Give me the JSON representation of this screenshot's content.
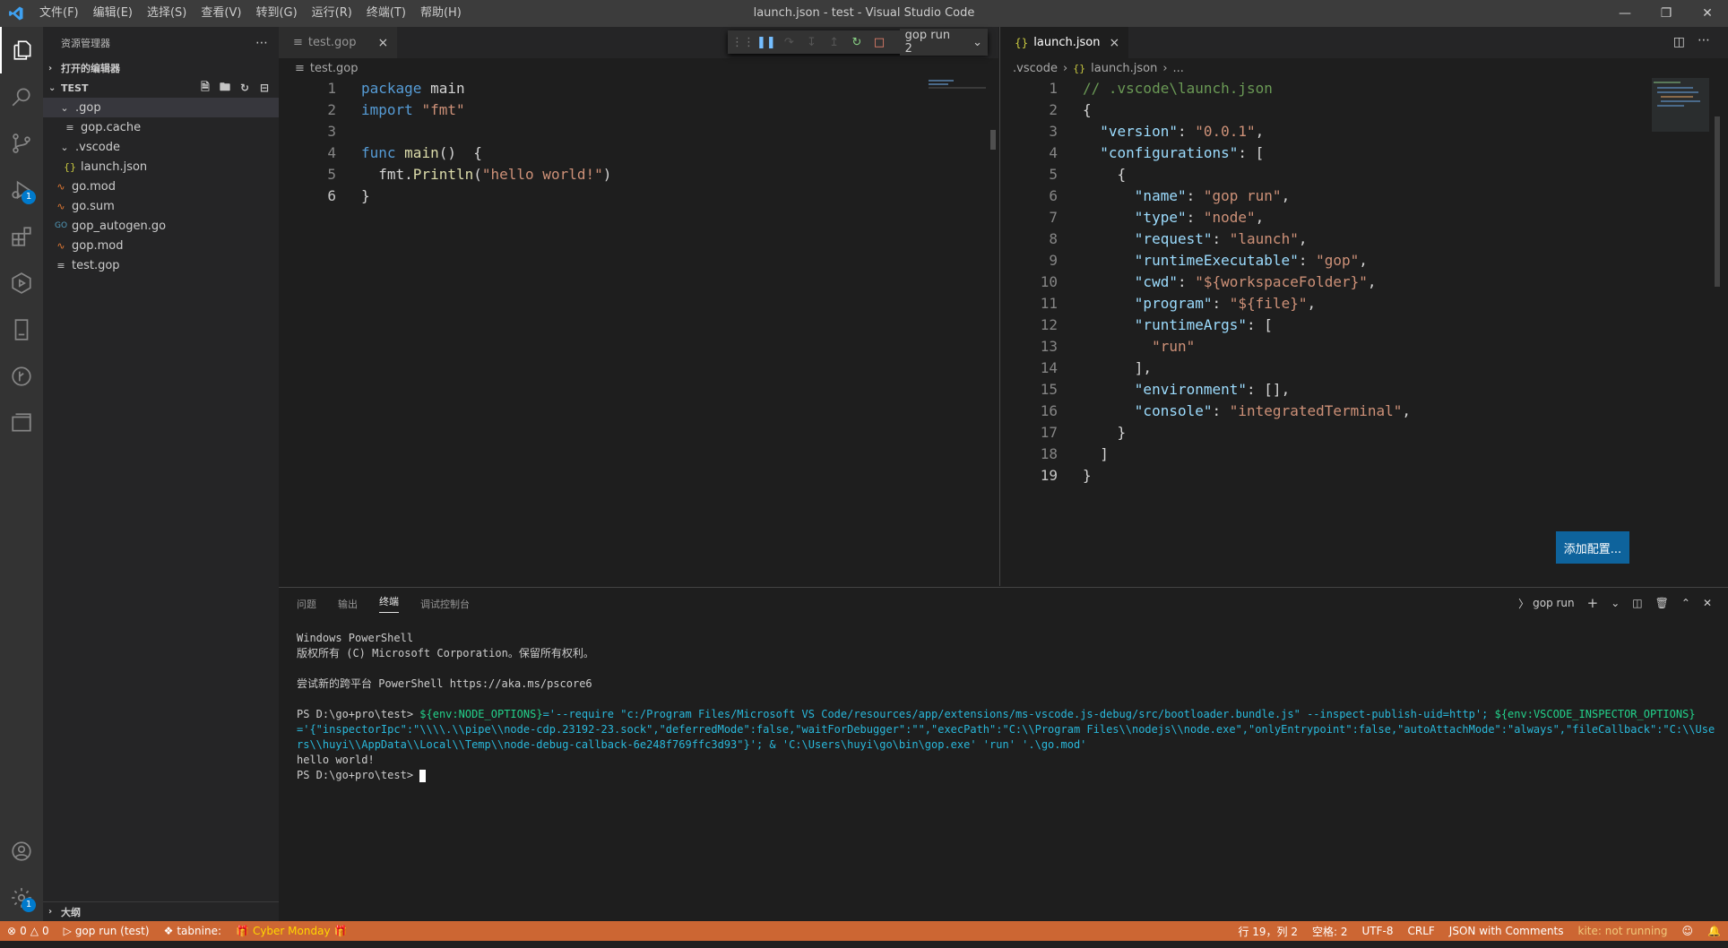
{
  "window": {
    "title": "launch.json - test - Visual Studio Code",
    "menu": [
      "文件(F)",
      "编辑(E)",
      "选择(S)",
      "查看(V)",
      "转到(G)",
      "运行(R)",
      "终端(T)",
      "帮助(H)"
    ]
  },
  "activity": {
    "run_badge": "1",
    "settings_badge": "1"
  },
  "sidebar": {
    "title": "资源管理器",
    "open_editors": "打开的编辑器",
    "folder": "TEST",
    "outline": "大纲",
    "tree": [
      {
        "label": ".gop",
        "type": "folder",
        "indent": 1
      },
      {
        "label": "gop.cache",
        "type": "file",
        "indent": 2
      },
      {
        "label": ".vscode",
        "type": "folder",
        "indent": 1
      },
      {
        "label": "launch.json",
        "type": "json",
        "indent": 2
      },
      {
        "label": "go.mod",
        "type": "mod",
        "indent": 1
      },
      {
        "label": "go.sum",
        "type": "mod",
        "indent": 1
      },
      {
        "label": "gop_autogen.go",
        "type": "go",
        "indent": 1
      },
      {
        "label": "gop.mod",
        "type": "mod",
        "indent": 1
      },
      {
        "label": "test.gop",
        "type": "file",
        "indent": 1
      }
    ]
  },
  "left_editor": {
    "tab": "test.gop",
    "breadcrumb": "test.gop",
    "lines": [
      {
        "n": "1",
        "parts": [
          {
            "c": "kw",
            "t": "package"
          },
          {
            "c": "plain",
            "t": " main"
          }
        ]
      },
      {
        "n": "2",
        "parts": [
          {
            "c": "kw",
            "t": "import"
          },
          {
            "c": "plain",
            "t": " "
          },
          {
            "c": "str",
            "t": "\"fmt\""
          }
        ]
      },
      {
        "n": "3",
        "parts": []
      },
      {
        "n": "4",
        "parts": [
          {
            "c": "kw",
            "t": "func"
          },
          {
            "c": "plain",
            "t": " "
          },
          {
            "c": "fn",
            "t": "main"
          },
          {
            "c": "plain",
            "t": "()  {"
          }
        ]
      },
      {
        "n": "5",
        "parts": [
          {
            "c": "plain",
            "t": "  fmt."
          },
          {
            "c": "fn",
            "t": "Println"
          },
          {
            "c": "plain",
            "t": "("
          },
          {
            "c": "str",
            "t": "\"hello world!\""
          },
          {
            "c": "plain",
            "t": ")"
          }
        ]
      },
      {
        "n": "6",
        "parts": [
          {
            "c": "plain",
            "t": "}"
          }
        ]
      }
    ]
  },
  "debug_toolbar": {
    "config": "gop run 2"
  },
  "right_editor": {
    "tab": "launch.json",
    "breadcrumb": [
      ".vscode",
      "launch.json",
      "..."
    ],
    "add_config": "添加配置...",
    "lines": [
      {
        "n": "1",
        "parts": [
          {
            "c": "cmt",
            "t": "// .vscode\\launch.json"
          }
        ]
      },
      {
        "n": "2",
        "parts": [
          {
            "c": "plain",
            "t": "{"
          }
        ]
      },
      {
        "n": "3",
        "parts": [
          {
            "c": "plain",
            "t": "  "
          },
          {
            "c": "key",
            "t": "\"version\""
          },
          {
            "c": "plain",
            "t": ": "
          },
          {
            "c": "str",
            "t": "\"0.0.1\""
          },
          {
            "c": "plain",
            "t": ","
          }
        ]
      },
      {
        "n": "4",
        "parts": [
          {
            "c": "plain",
            "t": "  "
          },
          {
            "c": "key",
            "t": "\"configurations\""
          },
          {
            "c": "plain",
            "t": ": ["
          }
        ]
      },
      {
        "n": "5",
        "parts": [
          {
            "c": "plain",
            "t": "    {"
          }
        ]
      },
      {
        "n": "6",
        "parts": [
          {
            "c": "plain",
            "t": "      "
          },
          {
            "c": "key",
            "t": "\"name\""
          },
          {
            "c": "plain",
            "t": ": "
          },
          {
            "c": "str",
            "t": "\"gop run\""
          },
          {
            "c": "plain",
            "t": ","
          }
        ]
      },
      {
        "n": "7",
        "parts": [
          {
            "c": "plain",
            "t": "      "
          },
          {
            "c": "key",
            "t": "\"type\""
          },
          {
            "c": "plain",
            "t": ": "
          },
          {
            "c": "str",
            "t": "\"node\""
          },
          {
            "c": "plain",
            "t": ","
          }
        ]
      },
      {
        "n": "8",
        "parts": [
          {
            "c": "plain",
            "t": "      "
          },
          {
            "c": "key",
            "t": "\"request\""
          },
          {
            "c": "plain",
            "t": ": "
          },
          {
            "c": "str",
            "t": "\"launch\""
          },
          {
            "c": "plain",
            "t": ","
          }
        ]
      },
      {
        "n": "9",
        "parts": [
          {
            "c": "plain",
            "t": "      "
          },
          {
            "c": "key",
            "t": "\"runtimeExecutable\""
          },
          {
            "c": "plain",
            "t": ": "
          },
          {
            "c": "str",
            "t": "\"gop\""
          },
          {
            "c": "plain",
            "t": ","
          }
        ]
      },
      {
        "n": "10",
        "parts": [
          {
            "c": "plain",
            "t": "      "
          },
          {
            "c": "key",
            "t": "\"cwd\""
          },
          {
            "c": "plain",
            "t": ": "
          },
          {
            "c": "str",
            "t": "\"${workspaceFolder}\""
          },
          {
            "c": "plain",
            "t": ","
          }
        ]
      },
      {
        "n": "11",
        "parts": [
          {
            "c": "plain",
            "t": "      "
          },
          {
            "c": "key",
            "t": "\"program\""
          },
          {
            "c": "plain",
            "t": ": "
          },
          {
            "c": "str",
            "t": "\"${file}\""
          },
          {
            "c": "plain",
            "t": ","
          }
        ]
      },
      {
        "n": "12",
        "parts": [
          {
            "c": "plain",
            "t": "      "
          },
          {
            "c": "key",
            "t": "\"runtimeArgs\""
          },
          {
            "c": "plain",
            "t": ": ["
          }
        ]
      },
      {
        "n": "13",
        "parts": [
          {
            "c": "plain",
            "t": "        "
          },
          {
            "c": "str",
            "t": "\"run\""
          }
        ]
      },
      {
        "n": "14",
        "parts": [
          {
            "c": "plain",
            "t": "      ],"
          }
        ]
      },
      {
        "n": "15",
        "parts": [
          {
            "c": "plain",
            "t": "      "
          },
          {
            "c": "key",
            "t": "\"environment\""
          },
          {
            "c": "plain",
            "t": ": [],"
          }
        ]
      },
      {
        "n": "16",
        "parts": [
          {
            "c": "plain",
            "t": "      "
          },
          {
            "c": "key",
            "t": "\"console\""
          },
          {
            "c": "plain",
            "t": ": "
          },
          {
            "c": "str",
            "t": "\"integratedTerminal\""
          },
          {
            "c": "plain",
            "t": ","
          }
        ]
      },
      {
        "n": "17",
        "parts": [
          {
            "c": "plain",
            "t": "    }"
          }
        ]
      },
      {
        "n": "18",
        "parts": [
          {
            "c": "plain",
            "t": "  ]"
          }
        ]
      },
      {
        "n": "19",
        "parts": [
          {
            "c": "plain",
            "t": "}"
          }
        ]
      }
    ]
  },
  "panel": {
    "tabs": [
      "问题",
      "输出",
      "终端",
      "调试控制台"
    ],
    "terminal_name": "gop run",
    "terminal_lines": [
      {
        "c": "",
        "t": "Windows PowerShell"
      },
      {
        "c": "",
        "t": "版权所有 (C) Microsoft Corporation。保留所有权利。"
      },
      {
        "c": "blank",
        "t": ""
      },
      {
        "c": "",
        "t": "尝试新的跨平台 PowerShell https://aka.ms/pscore6"
      },
      {
        "c": "blank",
        "t": ""
      }
    ],
    "prompt": "PS D:\\go+pro\\test> ",
    "command": "${env:NODE_OPTIONS}='--require \"c:/Program Files/Microsoft VS Code/resources/app/extensions/ms-vscode.js-debug/src/bootloader.bundle.js\" --inspect-publish-uid=http'; ${env:VSCODE_INSPECTOR_OPTIONS}='{\"inspectorIpc\":\"\\\\\\\\.\\\\pipe\\\\node-cdp.23192-23.sock\",\"deferredMode\":false,\"waitForDebugger\":\"\",\"execPath\":\"C:\\\\Program Files\\\\nodejs\\\\node.exe\",\"onlyEntrypoint\":false,\"autoAttachMode\":\"always\",\"fileCallback\":\"C:\\\\Users\\\\huyi\\\\AppData\\\\Local\\\\Temp\\\\node-debug-callback-6e248f769ffc3d93\"}'; & 'C:\\Users\\huyi\\go\\bin\\gop.exe' 'run' '.\\go.mod'",
    "output": "hello world!",
    "prompt2": "PS D:\\go+pro\\test> "
  },
  "statusbar": {
    "errors": "0",
    "warnings": "0",
    "debug": "gop run (test)",
    "tabnine": "tabnine:",
    "promo": "Cyber Monday",
    "position": "行 19，列 2",
    "spaces": "空格: 2",
    "encoding": "UTF-8",
    "eol": "CRLF",
    "language": "JSON with Comments",
    "kite": "kite: not running"
  },
  "colors": {
    "statusbar": "#cc6633",
    "accent": "#007acc"
  }
}
